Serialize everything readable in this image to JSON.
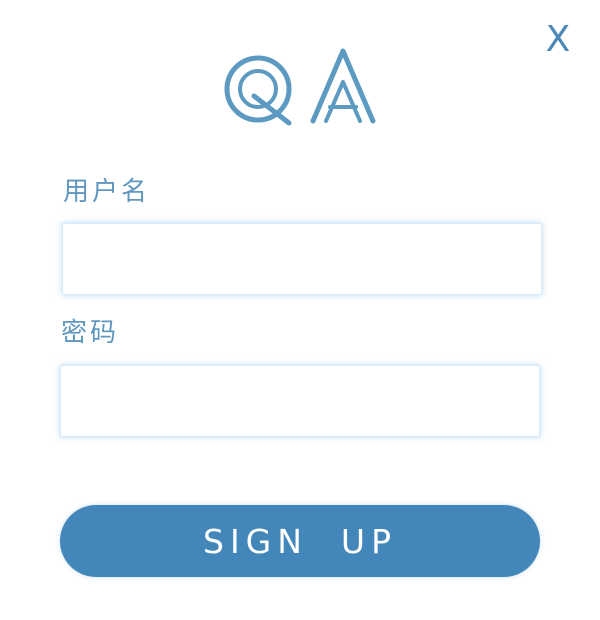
{
  "dialog": {
    "close_label": "X",
    "logo_text": "QA"
  },
  "form": {
    "username_label": "用户名",
    "password_label": "密码",
    "username_value": "",
    "password_value": "",
    "submit_label": "SIGN  UP"
  },
  "colors": {
    "accent": "#4387ba",
    "label": "#5f97bf",
    "input_glow": "#7db9e6"
  }
}
